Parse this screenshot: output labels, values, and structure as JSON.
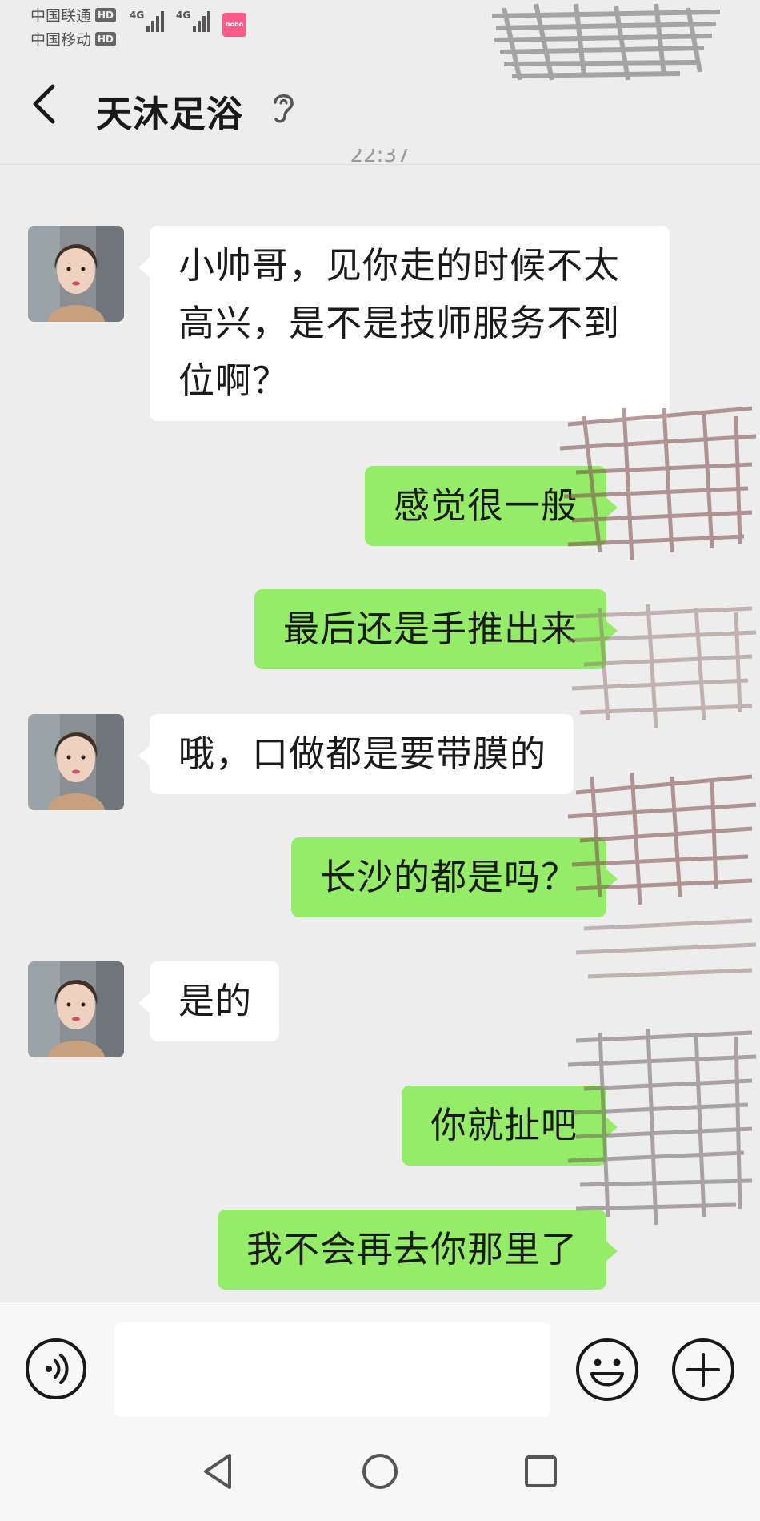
{
  "status_bar": {
    "carrier_1": "中国联通",
    "carrier_2": "中国移动",
    "hd_badge": "HD",
    "network_type": "4G",
    "app_badge_text": "bobo"
  },
  "header": {
    "title": "天沐足浴",
    "back_icon": "chevron-left-icon",
    "listen_mode_icon": "ear-icon"
  },
  "timestamp": "22:37",
  "messages": [
    {
      "side": "in",
      "lines": [
        "小帅哥，见你走的时候不太",
        "高兴，是不是技师服务不到",
        "位啊？"
      ]
    },
    {
      "side": "out",
      "text": "感觉很一般"
    },
    {
      "side": "out",
      "text": "最后还是手推出来"
    },
    {
      "side": "in",
      "text": "哦，口做都是要带膜的"
    },
    {
      "side": "out",
      "text": "长沙的都是吗？"
    },
    {
      "side": "in",
      "text": "是的"
    },
    {
      "side": "out",
      "text": "你就扯吧"
    },
    {
      "side": "out",
      "text": "我不会再去你那里了"
    }
  ],
  "input_bar": {
    "voice_icon": "voice-icon",
    "input_value": "",
    "emoji_icon": "smiley-icon",
    "more_icon": "plus-icon"
  },
  "nav_bar": {
    "back_icon": "triangle-back-icon",
    "home_icon": "circle-home-icon",
    "recents_icon": "square-recents-icon"
  },
  "colors": {
    "background": "#ededed",
    "incoming_bubble": "#ffffff",
    "outgoing_bubble": "#95ec69",
    "text": "#1a1a1a"
  }
}
